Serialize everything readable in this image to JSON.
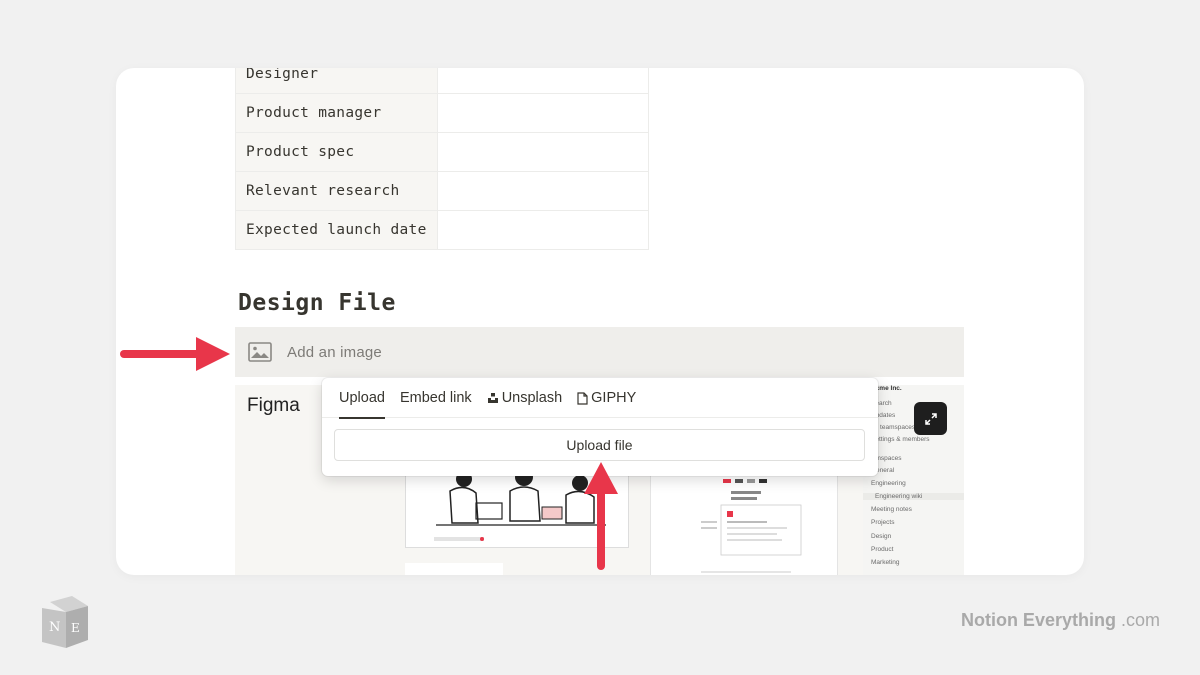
{
  "properties": [
    {
      "key": "Designer"
    },
    {
      "key": "Product manager"
    },
    {
      "key": "Product spec"
    },
    {
      "key": "Relevant research"
    },
    {
      "key": "Expected launch date"
    }
  ],
  "section_heading": "Design File",
  "add_image_label": "Add an image",
  "preview": {
    "label": "Figma",
    "sidebar": {
      "workspace": "Acme Inc.",
      "items": [
        "Search",
        "Updates",
        "All teamspaces",
        "Settings & members",
        "Teamspaces",
        "General",
        "Engineering",
        "Engineering wiki",
        "Meeting notes",
        "Projects",
        "Design",
        "Product",
        "Marketing"
      ]
    }
  },
  "popup": {
    "tabs": [
      {
        "label": "Upload",
        "active": true
      },
      {
        "label": "Embed link",
        "active": false
      },
      {
        "label": "Unsplash",
        "active": false,
        "icon": "unsplash-icon"
      },
      {
        "label": "GIPHY",
        "active": false,
        "icon": "file-icon"
      }
    ],
    "upload_button": "Upload file"
  },
  "branding": {
    "name": "Notion Everything",
    "suffix": ".com",
    "logo_letters": "NE"
  },
  "colors": {
    "arrow": "#e8364a",
    "background": "#f1f1f1",
    "accent_dark": "#37352f"
  }
}
